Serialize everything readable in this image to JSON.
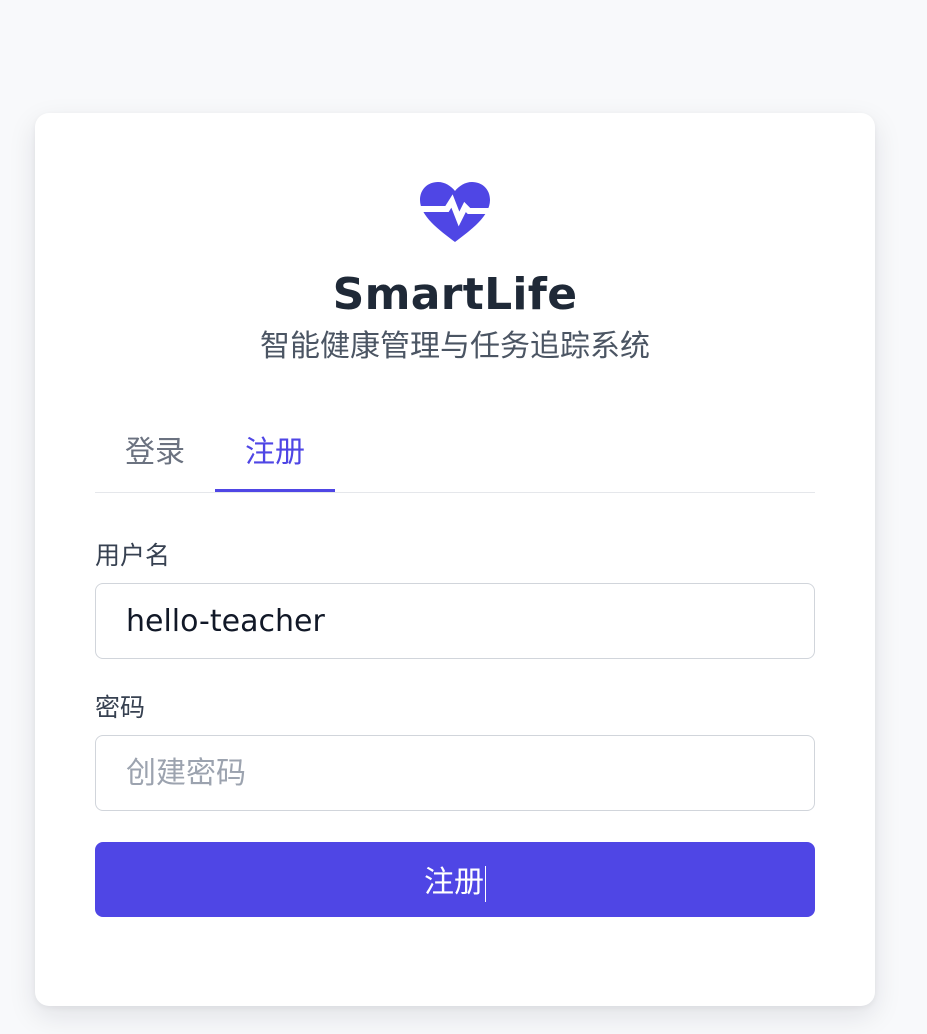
{
  "brand": {
    "name": "SmartLife",
    "subtitle": "智能健康管理与任务追踪系统",
    "logo_icon": "heart-pulse-icon",
    "accent_color": "#4f46e5"
  },
  "tabs": [
    {
      "label": "登录",
      "active": false
    },
    {
      "label": "注册",
      "active": true
    }
  ],
  "form": {
    "username": {
      "label": "用户名",
      "value": "hello-teacher",
      "placeholder": ""
    },
    "password": {
      "label": "密码",
      "value": "",
      "placeholder": "创建密码"
    },
    "submit_label": "注册"
  }
}
